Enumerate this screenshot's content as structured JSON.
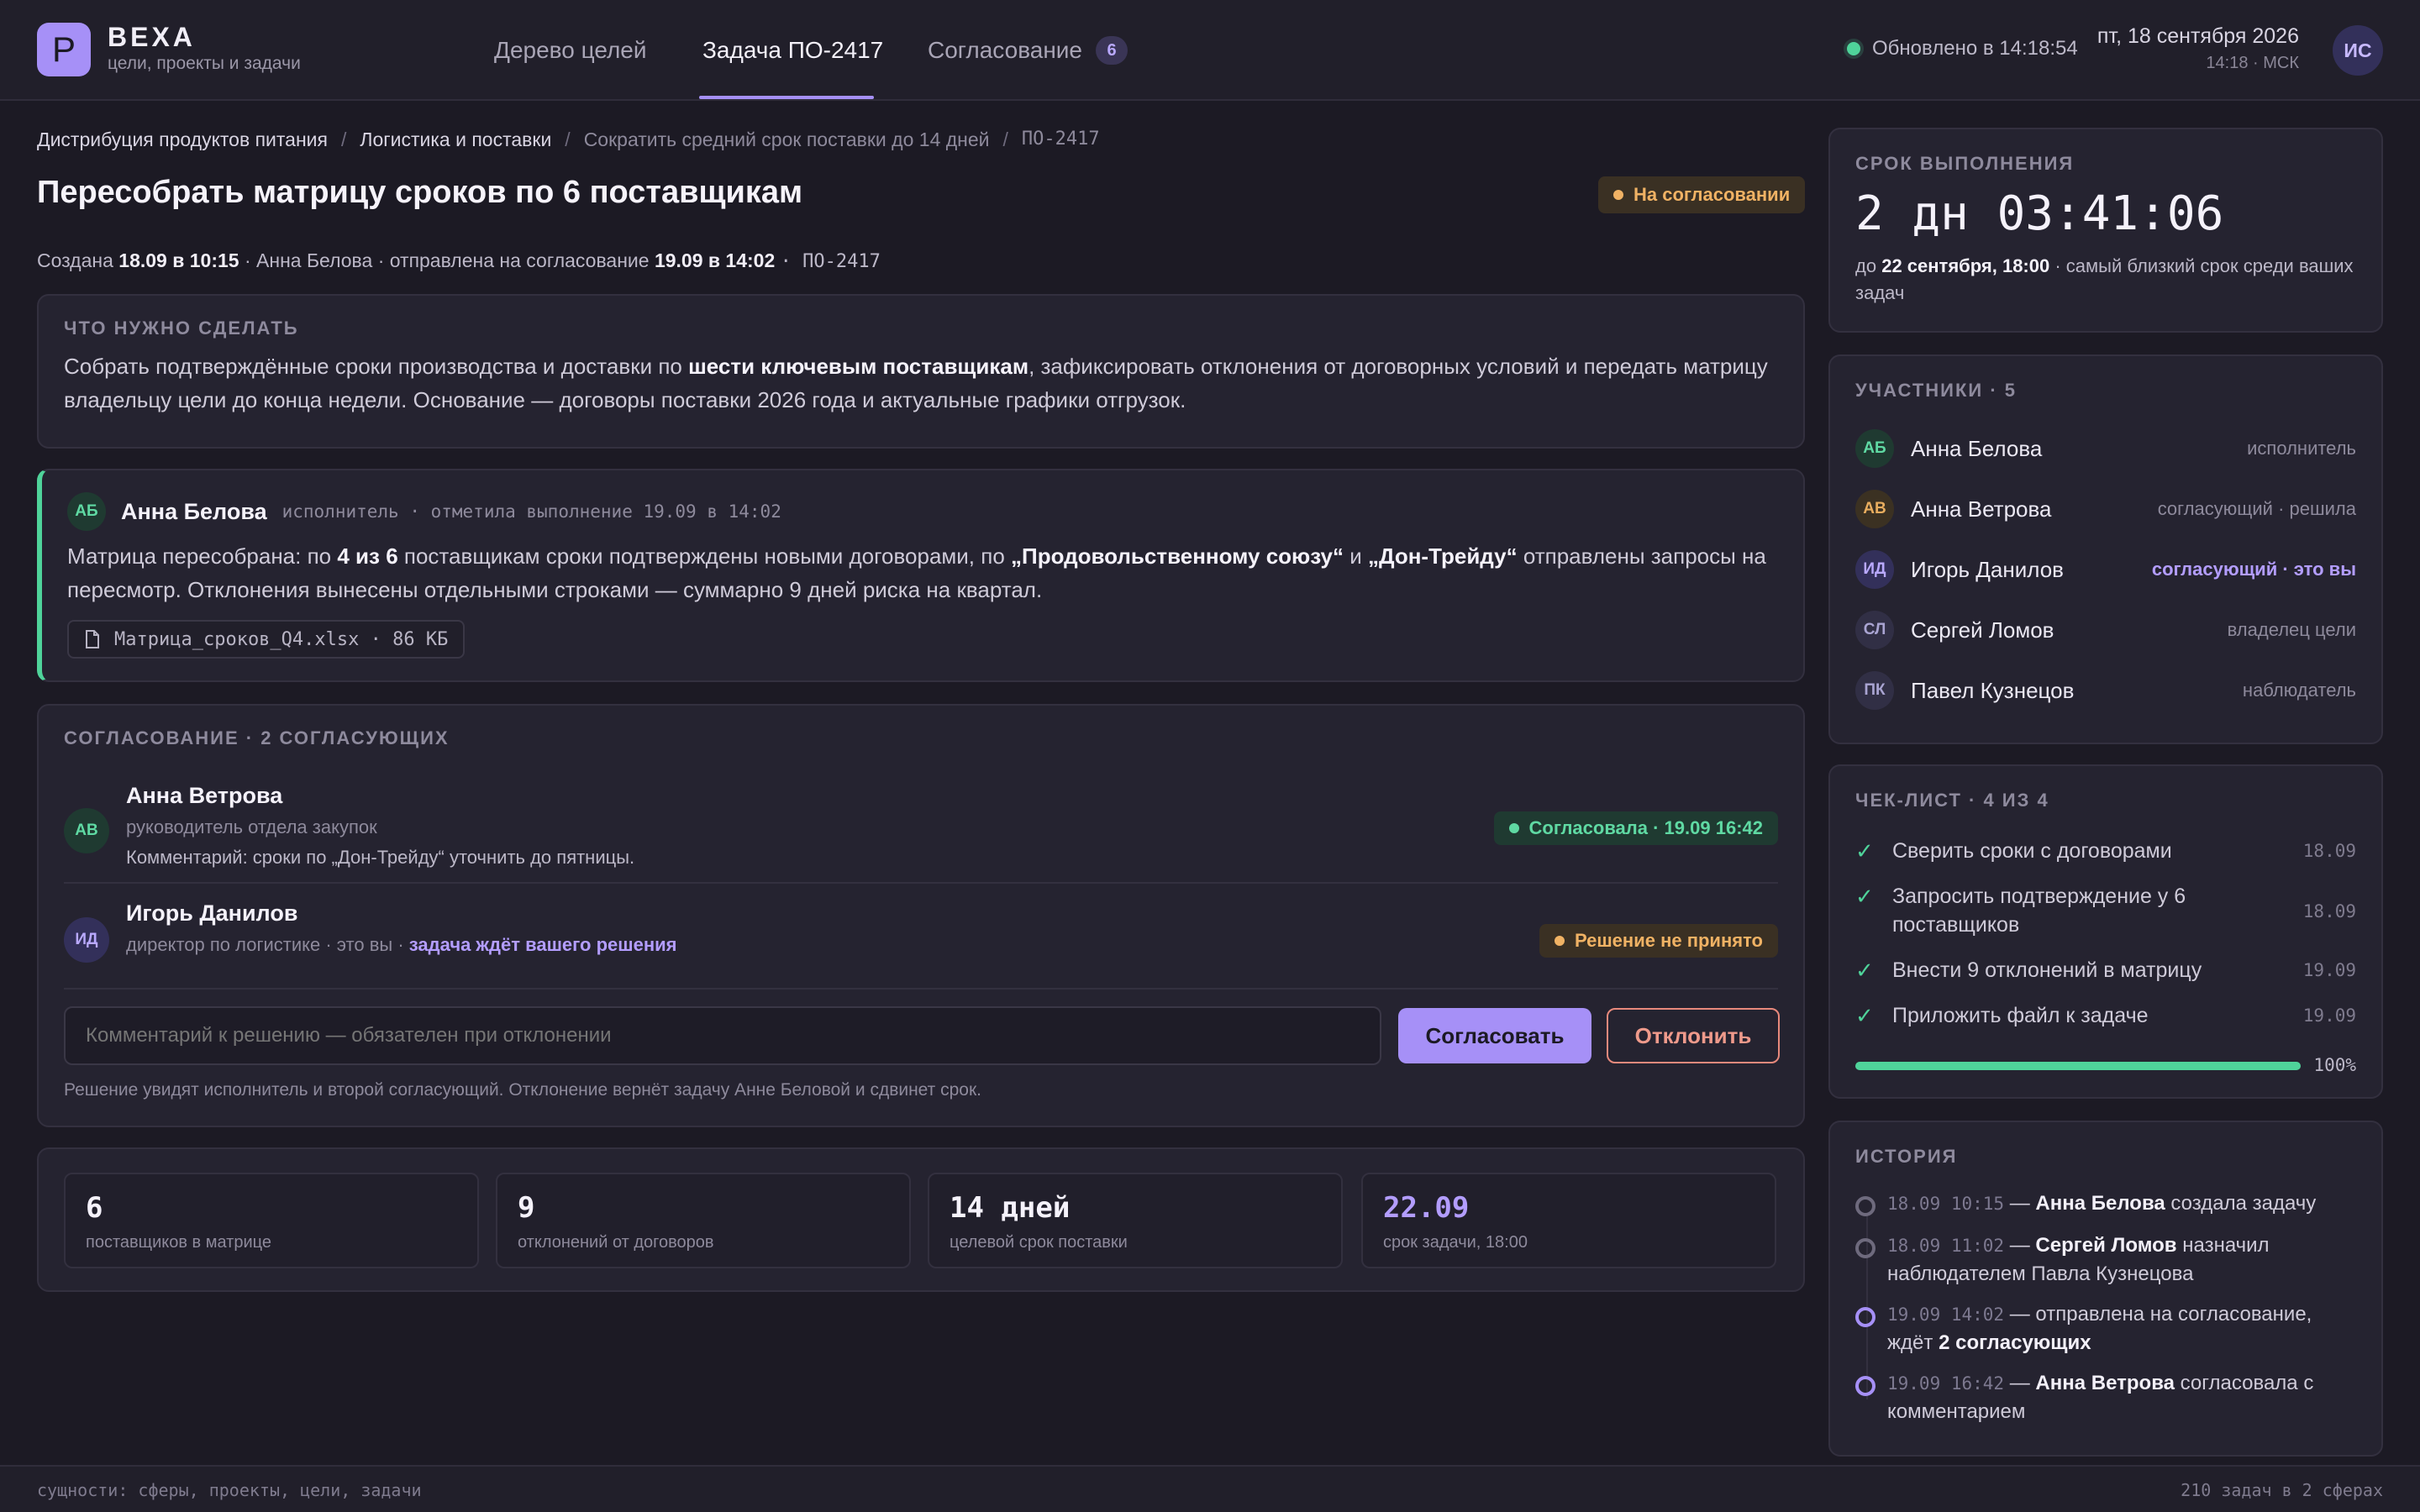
{
  "app": {
    "logo_letter": "P",
    "name": "ВЕХА",
    "subtitle": "цели, проекты и задачи"
  },
  "nav": {
    "tabs": [
      {
        "label": "Дерево целей"
      },
      {
        "label": "Задача ПО-2417"
      },
      {
        "label": "Согласование",
        "badge": "6"
      }
    ]
  },
  "status": {
    "updated": "Обновлено в 14:18:54"
  },
  "clock": {
    "date": "пт, 18 сентября 2026",
    "time": "14:18 · МСК"
  },
  "user": {
    "initials": "ИС"
  },
  "breadcrumb": [
    "Дистрибуция продуктов питания",
    "Логистика и поставки",
    "Сократить средний срок поставки до 14 дней",
    "ПО-2417"
  ],
  "task": {
    "title": "Пересобрать матрицу сроков по 6 поставщикам",
    "status_badge": "На согласовании",
    "meta": {
      "created_prefix": "Создана",
      "created_at": "18.09 в 10:15",
      "author_text": "· Анна Белова · отправлена на согласование",
      "sent_at": "19.09 в 14:02",
      "id": "· ПО-2417"
    }
  },
  "todo": {
    "label": "ЧТО НУЖНО СДЕЛАТЬ",
    "p1": "Собрать подтверждённые сроки производства и доставки по",
    "b1": "шести ключевым поставщикам",
    "p2": ", зафиксировать отклонения от договорных условий и передать матрицу владельцу цели до конца недели. Основание — договоры поставки 2026 года и актуальные графики отгрузок."
  },
  "report": {
    "initials": "АБ",
    "name": "Анна Белова",
    "meta": "исполнитель · отметила выполнение 19.09 в 14:02",
    "t1": "Матрица пересобрана: по",
    "b1": "4 из 6",
    "t2": "поставщикам сроки подтверждены новыми договорами, по",
    "b2": "„Продовольственному союзу“",
    "t3": "и",
    "b3": "„Дон-Трейду“",
    "t4": "отправлены запросы на пересмотр. Отклонения вынесены отдельными строками — суммарно 9 дней риска на квартал.",
    "file": "Матрица_сроков_Q4.xlsx · 86 КБ"
  },
  "approval": {
    "label": "СОГЛАСОВАНИЕ · 2 СОГЛАСУЮЩИХ",
    "approvers": [
      {
        "initials": "АВ",
        "name": "Анна Ветрова",
        "role": "руководитель отдела закупок",
        "comment": "Комментарий: сроки по „Дон-Трейду“ уточнить до пятницы.",
        "status": "Согласовала · 19.09 16:42"
      },
      {
        "initials": "ИД",
        "name": "Игорь Данилов",
        "role": "директор по логистике · это вы ·",
        "highlight": "задача ждёт вашего решения",
        "status": "Решение не принято"
      }
    ],
    "comment_placeholder": "Комментарий к решению — обязателен при отклонении",
    "approve_label": "Согласовать",
    "reject_label": "Отклонить",
    "hint": "Решение увидят исполнитель и второй согласующий. Отклонение вернёт задачу Анне Беловой и сдвинет срок."
  },
  "kpis": [
    {
      "value": "6",
      "caption": "поставщиков в матрице"
    },
    {
      "value": "9",
      "caption": "отклонений от договоров"
    },
    {
      "value": "14 дней",
      "caption": "целевой срок поставки"
    },
    {
      "value": "22.09",
      "caption": "срок задачи, 18:00"
    }
  ],
  "deadline": {
    "label": "СРОК ВЫПОЛНЕНИЯ",
    "countdown": "2 дн 03:41:06",
    "prefix": "до",
    "date": "22 сентября, 18:00",
    "note": "· самый близкий срок среди ваших задач"
  },
  "participants": {
    "label": "УЧАСТНИКИ · 5",
    "items": [
      {
        "initials": "АБ",
        "name": "Анна Белова",
        "role": "исполнитель"
      },
      {
        "initials": "АВ",
        "name": "Анна Ветрова",
        "role": "согласующий · решила"
      },
      {
        "initials": "ИД",
        "name": "Игорь Данилов",
        "role": "согласующий · это вы"
      },
      {
        "initials": "СЛ",
        "name": "Сергей Ломов",
        "role": "владелец цели"
      },
      {
        "initials": "ПК",
        "name": "Павел Кузнецов",
        "role": "наблюдатель"
      }
    ]
  },
  "checklist": {
    "label": "ЧЕК-ЛИСТ · 4 ИЗ 4",
    "items": [
      {
        "text": "Сверить сроки с договорами",
        "date": "18.09"
      },
      {
        "text": "Запросить подтверждение у 6 поставщиков",
        "date": "18.09"
      },
      {
        "text": "Внести 9 отклонений в матрицу",
        "date": "19.09"
      },
      {
        "text": "Приложить файл к задаче",
        "date": "19.09"
      }
    ],
    "progress": 1.0,
    "progress_label": "100%"
  },
  "history": {
    "label": "ИСТОРИЯ",
    "items": [
      {
        "time": "18.09 10:15",
        "sep": " — ",
        "actor": "Анна Белова",
        "text": " создала задачу"
      },
      {
        "time": "18.09 11:02",
        "sep": " — ",
        "actor": "Сергей Ломов",
        "text": " назначил наблюдателем Павла Кузнецова"
      },
      {
        "time": "19.09 14:02",
        "sep": " — ",
        "actor": "",
        "text": "отправлена на согласование, ждёт",
        "bold_tail": "2 согласующих"
      },
      {
        "time": "19.09 16:42",
        "sep": " — ",
        "actor": "Анна Ветрова",
        "text": " согласовала с комментарием"
      }
    ]
  },
  "footer": {
    "left": "сущности: сферы, проекты, цели, задачи",
    "right": "210 задач в 2 сферах"
  },
  "colors": {
    "accent": "#a690f7",
    "success": "#4fd39a",
    "warning": "#f0b264",
    "danger": "#e8897c",
    "background": "#1c1a24"
  }
}
